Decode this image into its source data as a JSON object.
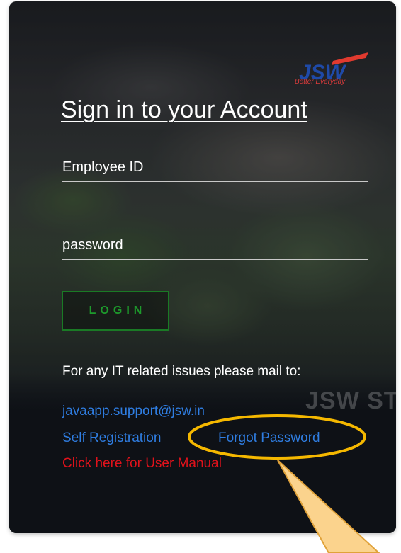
{
  "logo": {
    "text": "JSW",
    "tagline": "Better Everyday"
  },
  "title": "Sign in to your Account",
  "form": {
    "employee_placeholder": "Employee ID",
    "password_placeholder": "password",
    "login_label": "LOGIN"
  },
  "support": {
    "note": "For any IT related issues please mail to:",
    "email": "javaapp.support@jsw.in"
  },
  "links": {
    "self_registration": "Self Registration",
    "forgot_password": "Forgot Password",
    "user_manual": "Click here for User Manual"
  },
  "background": {
    "watermark": "JSW ST"
  },
  "colors": {
    "link_blue": "#2f7de1",
    "manual_red": "#e0121b",
    "login_green": "#1d9a2c",
    "highlight": "#f5b800",
    "callout": "#fbd38d"
  }
}
